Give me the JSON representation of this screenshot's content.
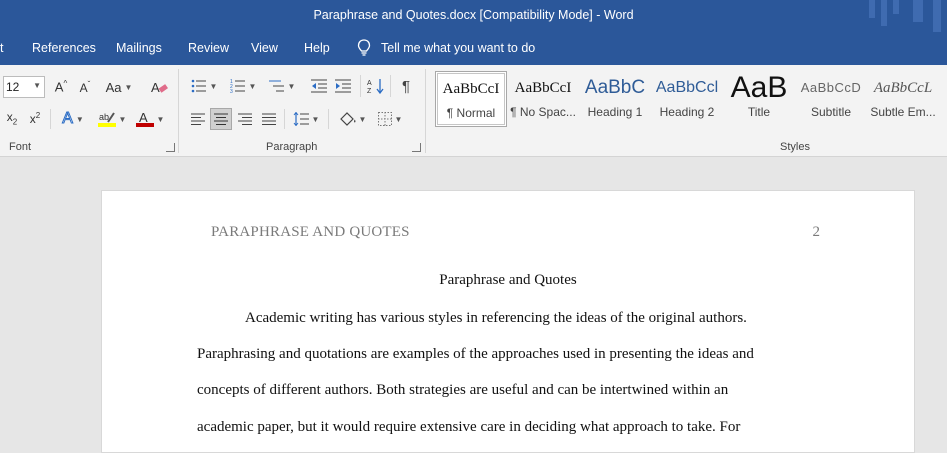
{
  "window": {
    "title": "Paraphrase and Quotes.docx [Compatibility Mode]  -  Word"
  },
  "menu": {
    "tabs": [
      "t",
      "References",
      "Mailings",
      "Review",
      "View",
      "Help"
    ],
    "tell_me": "Tell me what you want to do"
  },
  "ribbon": {
    "font": {
      "size": "12",
      "label": "Font"
    },
    "paragraph": {
      "label": "Paragraph"
    },
    "styles": {
      "label": "Styles",
      "items": [
        {
          "sample": "AaBbCcI",
          "name": "¶ Normal",
          "selected": true
        },
        {
          "sample": "AaBbCcI",
          "name": "¶ No Spac..."
        },
        {
          "sample": "AaBbC",
          "name": "Heading 1"
        },
        {
          "sample": "AaBbCcl",
          "name": "Heading 2"
        },
        {
          "sample": "AaB",
          "name": "Title"
        },
        {
          "sample": "AaBbCcD",
          "name": "Subtitle"
        },
        {
          "sample": "AaBbCcL",
          "name": "Subtle Em..."
        }
      ]
    },
    "colors": {
      "highlight": "#ffff00",
      "font_color": "#c00000",
      "accent": "#2b579a"
    }
  },
  "document": {
    "header": "PARAPHRASE AND QUOTES",
    "page_number": "2",
    "title": "Paraphrase and Quotes",
    "lines": [
      "Academic writing has various styles in referencing the ideas of the original authors.",
      "Paraphrasing and quotations are examples of the approaches used in presenting the ideas and",
      "concepts of different authors. Both strategies are useful and can be intertwined within an",
      "academic paper, but it would require extensive care in deciding what approach to take. For"
    ]
  }
}
